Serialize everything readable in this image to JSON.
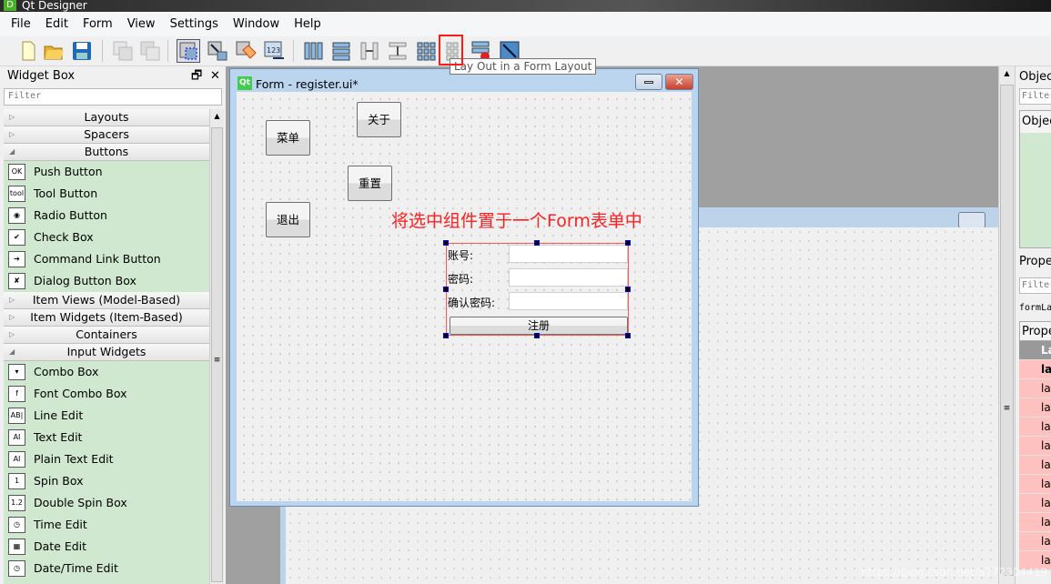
{
  "app": {
    "title": "Qt Designer",
    "logo_letter": "D"
  },
  "menu": [
    "File",
    "Edit",
    "Form",
    "View",
    "Settings",
    "Window",
    "Help"
  ],
  "toolbar": {
    "tooltip": "Lay Out in a Form Layout",
    "highlight_color": "#ff1a1a"
  },
  "widget_box": {
    "title": "Widget Box",
    "filter_placeholder": "Filter",
    "sections": [
      {
        "label": "Layouts",
        "expanded": false,
        "items": []
      },
      {
        "label": "Spacers",
        "expanded": false,
        "items": []
      },
      {
        "label": "Buttons",
        "expanded": true,
        "items": [
          {
            "label": "Push Button",
            "icon": "OK"
          },
          {
            "label": "Tool Button",
            "icon": "tool"
          },
          {
            "label": "Radio Button",
            "icon": "◉"
          },
          {
            "label": "Check Box",
            "icon": "✔"
          },
          {
            "label": "Command Link Button",
            "icon": "➔"
          },
          {
            "label": "Dialog Button Box",
            "icon": "✘"
          }
        ]
      },
      {
        "label": "Item Views (Model-Based)",
        "expanded": false,
        "items": []
      },
      {
        "label": "Item Widgets (Item-Based)",
        "expanded": false,
        "items": []
      },
      {
        "label": "Containers",
        "expanded": false,
        "items": []
      },
      {
        "label": "Input Widgets",
        "expanded": true,
        "items": [
          {
            "label": "Combo Box",
            "icon": "▾"
          },
          {
            "label": "Font Combo Box",
            "icon": "f"
          },
          {
            "label": "Line Edit",
            "icon": "AB|"
          },
          {
            "label": "Text Edit",
            "icon": "AI"
          },
          {
            "label": "Plain Text Edit",
            "icon": "AI"
          },
          {
            "label": "Spin Box",
            "icon": "1"
          },
          {
            "label": "Double Spin Box",
            "icon": "1.2"
          },
          {
            "label": "Time Edit",
            "icon": "◷"
          },
          {
            "label": "Date Edit",
            "icon": "▦"
          },
          {
            "label": "Date/Time Edit",
            "icon": "◷"
          }
        ]
      }
    ]
  },
  "form": {
    "title": "Form - register.ui*",
    "qt_logo": "Qt",
    "buttons": {
      "menu": "菜单",
      "about": "关于",
      "reset": "重置",
      "exit": "退出"
    },
    "annotation": "将选中组件置于一个Form表单中",
    "annotation_color": "#ff2020",
    "layout": {
      "labels": [
        "账号:",
        "密码:",
        "确认密码:"
      ],
      "register": "注册"
    }
  },
  "right_panel": {
    "object_inspector": "Objec",
    "filter": "Filter",
    "object_header": "Objec",
    "property_editor": "Prope",
    "prop_filter": "Filter",
    "object_name": "formLa",
    "prop_header": "Prope",
    "group": "La",
    "rows": [
      "lay",
      "lay",
      "lay",
      "lay",
      "lay",
      "lay",
      "lay",
      "lay",
      "lay",
      "lay",
      "lay"
    ]
  },
  "watermark": "https://blog.csdn.net/a772304419"
}
